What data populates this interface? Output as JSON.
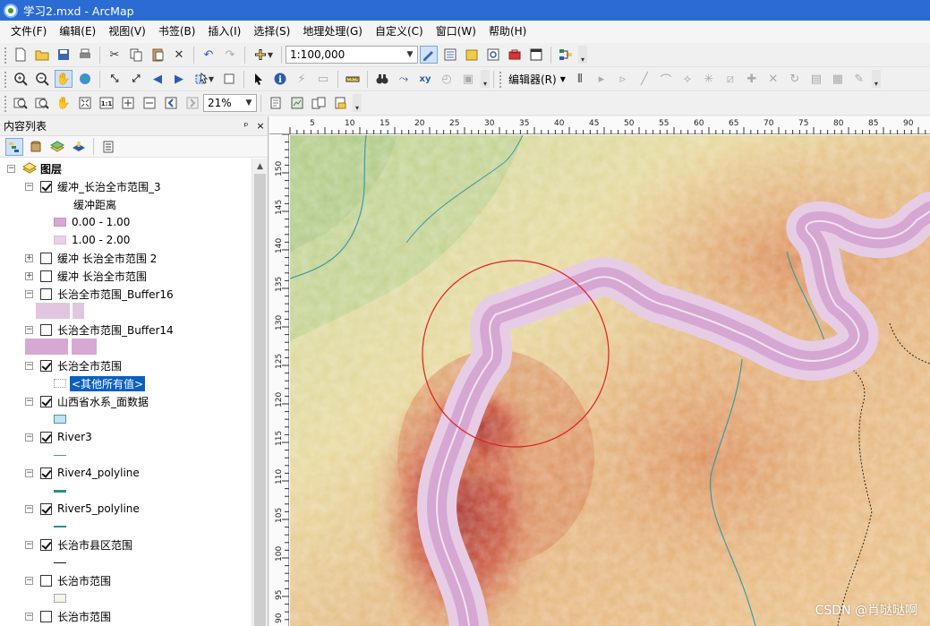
{
  "window": {
    "title": "学习2.mxd - ArcMap"
  },
  "menu": [
    "文件(F)",
    "编辑(E)",
    "视图(V)",
    "书签(B)",
    "插入(I)",
    "选择(S)",
    "地理处理(G)",
    "自定义(C)",
    "窗口(W)",
    "帮助(H)"
  ],
  "toolbar": {
    "scale_value": "1:100,000",
    "editor_label": "编辑器(R)",
    "zoom_value": "21%"
  },
  "toc": {
    "title": "内容列表",
    "pin": "ᵖ",
    "close": "×",
    "root_label": "图层",
    "layers": [
      {
        "name": "缓冲_长治全市范围_3",
        "checked": true,
        "expanded": true
      },
      {
        "name": "缓冲距离"
      },
      {
        "name": "0.00 - 1.00"
      },
      {
        "name": "1.00 - 2.00"
      },
      {
        "name": "缓冲 长治全市范围 2",
        "checked": false,
        "expanded": false
      },
      {
        "name": "缓冲 长治全市范围",
        "checked": false,
        "expanded": false
      },
      {
        "name": "长治全市范围_Buffer16",
        "checked": false,
        "expanded": true
      },
      {
        "name": "长治全市范围_Buffer14",
        "checked": false,
        "expanded": true
      },
      {
        "name": "长治全市范围",
        "checked": true,
        "expanded": true
      },
      {
        "name": "<其他所有值>"
      },
      {
        "name": "山西省水系_面数据",
        "checked": true,
        "expanded": true
      },
      {
        "name": "River3",
        "checked": true,
        "expanded": true
      },
      {
        "name": "River4_polyline",
        "checked": true,
        "expanded": true
      },
      {
        "name": "River5_polyline",
        "checked": true,
        "expanded": true
      },
      {
        "name": "长治市县区范围",
        "checked": true,
        "expanded": true
      },
      {
        "name": "长治市范围",
        "checked": false,
        "expanded": true
      },
      {
        "name": "长治市范围",
        "checked": false,
        "expanded": true
      }
    ],
    "colors": {
      "buffer_01": "#d8a8d4",
      "buffer_12": "#e9d2e8",
      "water_fill": "#bfe3f0",
      "river": "#3b9aa9",
      "city_fill": "#f6f4e6"
    }
  },
  "map": {
    "ruler_top": [
      "5",
      "10",
      "15",
      "20",
      "25",
      "30",
      "35",
      "40",
      "45",
      "50",
      "55",
      "60",
      "65",
      "70",
      "75",
      "80",
      "85",
      "90"
    ],
    "ruler_left": [
      "150",
      "145",
      "140",
      "135",
      "130",
      "125",
      "120",
      "115",
      "110",
      "105",
      "100",
      "95",
      "90"
    ],
    "watermark": "CSDN @肖哒哒啊"
  }
}
